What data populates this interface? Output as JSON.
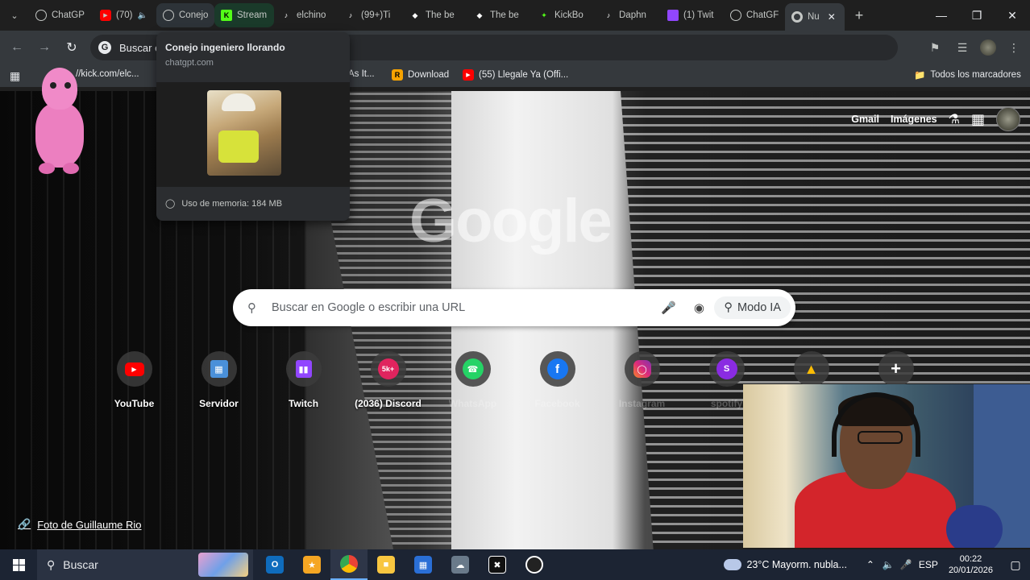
{
  "tabs": [
    {
      "label": "ChatGP",
      "icon": "openai-icon",
      "color": "#c4c7c5"
    },
    {
      "label": "(70)",
      "icon": "youtube-icon",
      "color": "#ff0000",
      "audio": "speaker-icon"
    },
    {
      "label": "Conejo",
      "icon": "openai-icon",
      "color": "#c4c7c5",
      "state": "hover"
    },
    {
      "label": "Stream",
      "icon": "kick-icon",
      "color": "#53fc18",
      "state": "green"
    },
    {
      "label": "elchino",
      "icon": "tiktok-icon",
      "color": "#ffffff"
    },
    {
      "label": "(99+)Ti",
      "icon": "tiktok-icon",
      "color": "#ffffff"
    },
    {
      "label": "The be",
      "icon": "gemini-diamond-icon",
      "color": "#ffffff"
    },
    {
      "label": "The be",
      "icon": "gemini-diamond-icon",
      "color": "#ffffff"
    },
    {
      "label": "KickBo",
      "icon": "kickbot-icon",
      "color": "#53fc18"
    },
    {
      "label": "Daphn",
      "icon": "tiktok-icon",
      "color": "#ffffff"
    },
    {
      "label": "(1) Twit",
      "icon": "twitch-icon",
      "color": "#9146ff"
    },
    {
      "label": "ChatGF",
      "icon": "openai-icon",
      "color": "#c4c7c5"
    },
    {
      "label": "Nu",
      "icon": "chrome-icon",
      "color": "#c4c7c5",
      "state": "active"
    }
  ],
  "omnibox": {
    "text": "Buscar e"
  },
  "hovercard": {
    "title": "Conejo ingeniero llorando",
    "url": "chatgpt.com",
    "memory": "Uso de memoria: 184 MB"
  },
  "bookmarks": {
    "items": [
      {
        "label": "//kick.com/elc...",
        "icon": "kick-icon"
      },
      {
        "label": "As It...",
        "icon": ""
      },
      {
        "label": "Download",
        "icon": "r-icon"
      },
      {
        "label": "(55) Llegale Ya (Offi...",
        "icon": "youtube-icon"
      }
    ],
    "all": "Todos los marcadores"
  },
  "ntp": {
    "gmail": "Gmail",
    "images": "Imágenes",
    "logo": "Google",
    "search_placeholder": "Buscar en Google o escribir una URL",
    "ai_mode": "Modo IA",
    "credit": "Foto de Guillaume Rio"
  },
  "shortcuts": [
    {
      "label": "YouTube",
      "icon": "youtube-icon",
      "color": "#ff0000"
    },
    {
      "label": "Servidor",
      "icon": "server-icon",
      "color": "#4a90d9"
    },
    {
      "label": "Twitch",
      "icon": "twitch-icon",
      "color": "#9146ff"
    },
    {
      "label": "(2036) Discord",
      "icon": "discord-icon",
      "color": "#e0245e",
      "badge": "5k+"
    },
    {
      "label": "WhatsApp",
      "icon": "whatsapp-icon",
      "color": "#25d366"
    },
    {
      "label": "Facebook",
      "icon": "facebook-icon",
      "color": "#1877f2"
    },
    {
      "label": "Instagram",
      "icon": "instagram-icon",
      "color": "#d6249f"
    },
    {
      "label": "spotify",
      "icon": "s-icon",
      "color": "#8a2be2"
    },
    {
      "label": "",
      "icon": "google-drive-icon",
      "color": "#34a853"
    },
    {
      "label": "",
      "icon": "plus-icon",
      "color": "#3c3c3c"
    }
  ],
  "taskbar": {
    "search": "Buscar",
    "weather": "23°C  Mayorm. nubla...",
    "lang": "ESP",
    "time": "00:22",
    "date": "20/01/2026"
  }
}
